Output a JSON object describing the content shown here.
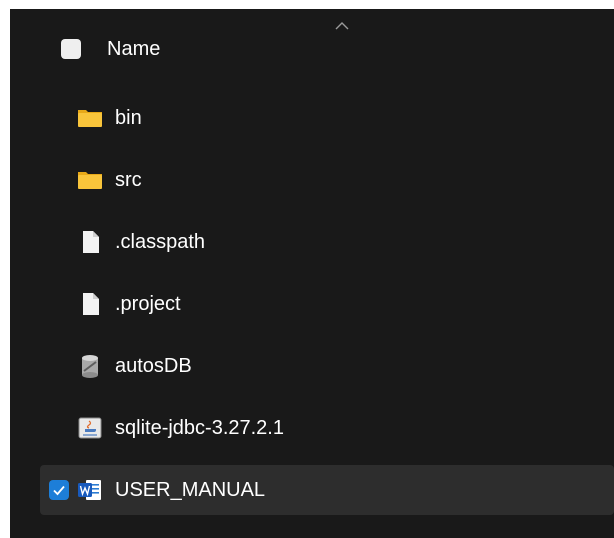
{
  "header": {
    "column_label": "Name",
    "sort_direction": "ascending",
    "sort_icon": "chevron-up-icon"
  },
  "colors": {
    "background": "#191919",
    "selected_row": "#2d2d2d",
    "checkbox_accent": "#1d7ed8",
    "folder": "#f9c53b",
    "text": "#ffffff"
  },
  "files": [
    {
      "name": "bin",
      "icon": "folder-icon",
      "selected": false
    },
    {
      "name": "src",
      "icon": "folder-icon",
      "selected": false
    },
    {
      "name": ".classpath",
      "icon": "file-icon",
      "selected": false
    },
    {
      "name": ".project",
      "icon": "file-icon",
      "selected": false
    },
    {
      "name": "autosDB",
      "icon": "database-file-icon",
      "selected": false
    },
    {
      "name": "sqlite-jdbc-3.27.2.1",
      "icon": "java-jar-icon",
      "selected": false
    },
    {
      "name": "USER_MANUAL",
      "icon": "word-document-icon",
      "selected": true
    }
  ]
}
